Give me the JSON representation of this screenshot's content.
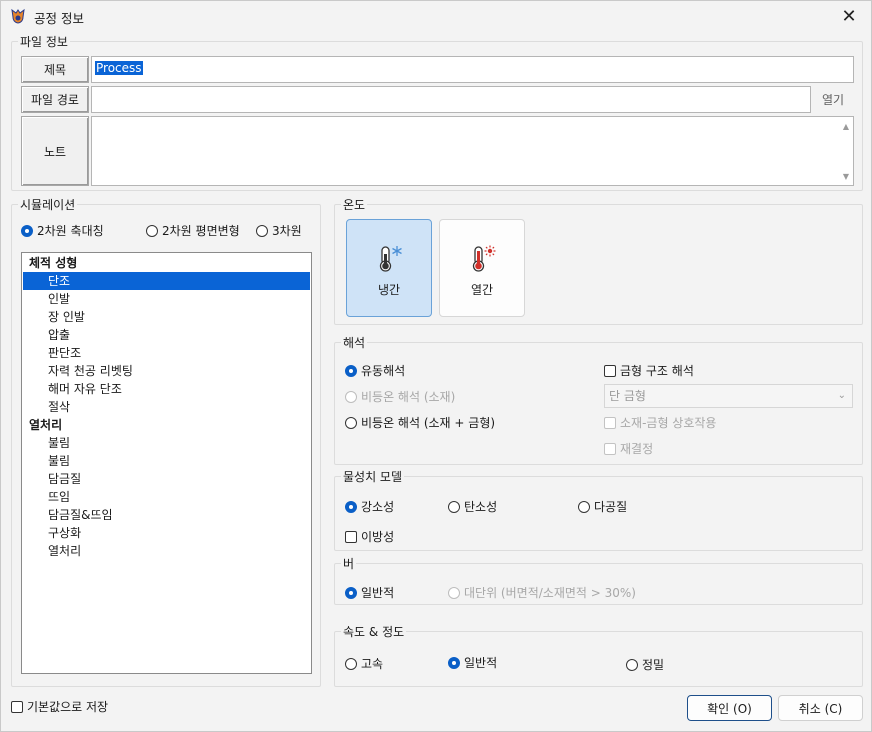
{
  "window": {
    "title": "공정 정보",
    "close_glyph": "✕"
  },
  "file_info": {
    "legend": "파일 정보",
    "title_label": "제목",
    "title_value": "Process",
    "path_label": "파일 경로",
    "path_value": "",
    "open_label": "열기",
    "note_label": "노트",
    "note_value": ""
  },
  "simulation": {
    "legend": "시뮬레이션",
    "modes": [
      {
        "label": "2차원 축대칭",
        "selected": true
      },
      {
        "label": "2차원 평면변형",
        "selected": false
      },
      {
        "label": "3차원",
        "selected": false
      }
    ],
    "tree": [
      {
        "label": "체적 성형",
        "type": "cat"
      },
      {
        "label": "단조",
        "type": "sub",
        "selected": true
      },
      {
        "label": "인발",
        "type": "sub"
      },
      {
        "label": "장 인발",
        "type": "sub"
      },
      {
        "label": "압출",
        "type": "sub"
      },
      {
        "label": "판단조",
        "type": "sub"
      },
      {
        "label": "자력 천공 리벳팅",
        "type": "sub"
      },
      {
        "label": "해머 자유 단조",
        "type": "sub"
      },
      {
        "label": "절삭",
        "type": "sub"
      },
      {
        "label": "열처리",
        "type": "cat"
      },
      {
        "label": "불림",
        "type": "sub"
      },
      {
        "label": "불림",
        "type": "sub"
      },
      {
        "label": "담금질",
        "type": "sub"
      },
      {
        "label": "뜨임",
        "type": "sub"
      },
      {
        "label": "담금질&뜨임",
        "type": "sub"
      },
      {
        "label": "구상화",
        "type": "sub"
      },
      {
        "label": "열처리",
        "type": "sub"
      }
    ]
  },
  "temperature": {
    "legend": "온도",
    "cold_label": "냉간",
    "hot_label": "열간",
    "selected": "cold"
  },
  "analysis": {
    "legend": "해석",
    "options": [
      {
        "label": "유동해석",
        "selected": true,
        "disabled": false
      },
      {
        "label": "비등온 해석 (소재)",
        "selected": false,
        "disabled": true
      },
      {
        "label": "비등온 해석 (소재 + 금형)",
        "selected": false,
        "disabled": false
      }
    ],
    "die_struct_label": "금형 구조 해석",
    "die_combo_value": "단 금형",
    "interaction_label": "소재-금형 상호작용",
    "recrystal_label": "재결정"
  },
  "property_model": {
    "legend": "물성치 모델",
    "options": [
      {
        "label": "강소성",
        "selected": true
      },
      {
        "label": "탄소성",
        "selected": false
      },
      {
        "label": "다공질",
        "selected": false
      }
    ],
    "anisotropy_label": "이방성"
  },
  "burr": {
    "legend": "버",
    "options": [
      {
        "label": "일반적",
        "selected": true,
        "disabled": false
      },
      {
        "label": "대단위 (버면적/소재면적 > 30%)",
        "selected": false,
        "disabled": true
      }
    ]
  },
  "speed_accuracy": {
    "legend": "속도 & 정도",
    "options": [
      {
        "label": "고속",
        "selected": false
      },
      {
        "label": "일반적",
        "selected": true
      },
      {
        "label": "정밀",
        "selected": false
      }
    ]
  },
  "footer": {
    "save_default_label": "기본값으로 저장",
    "ok_label": "확인 (O)",
    "cancel_label": "취소 (C)"
  },
  "colors": {
    "accent": "#0a64d6",
    "radio_on": "#0a5fc7",
    "cold_bg": "#cfe3f7",
    "disabled_text": "#a7a7a7"
  }
}
